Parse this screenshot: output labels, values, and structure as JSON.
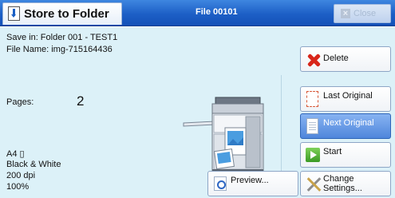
{
  "header": {
    "title": "Store to Folder",
    "file_label": "File 00101",
    "close_label": "Close"
  },
  "info": {
    "save_in": "Save in: Folder 001 - TEST1",
    "file_name": "File Name: img-715164436",
    "pages_label": "Pages:",
    "pages_count": "2",
    "paper_size": "A4 ▯",
    "color_mode": "Black & White",
    "resolution": "200 dpi",
    "scale": "100%"
  },
  "buttons": {
    "delete": "Delete",
    "last_original": "Last Original",
    "next_original": "Next Original",
    "start": "Start",
    "preview": "Preview...",
    "change_settings_line1": "Change",
    "change_settings_line2": "Settings..."
  },
  "icons": {
    "title": "document-download-icon",
    "close": "close-icon",
    "delete": "red-x-icon",
    "last_original": "page-icon",
    "next_original": "page-icon",
    "start": "start-icon",
    "preview": "preview-icon",
    "change_settings": "tools-icon",
    "machine": "multifunction-printer-icon"
  },
  "colors": {
    "title_bar": "#1d5fc6",
    "content_bg": "#dcf1f8",
    "active_button": "#4f86db",
    "delete_icon": "#d8261a",
    "start_icon": "#3b9a25"
  }
}
